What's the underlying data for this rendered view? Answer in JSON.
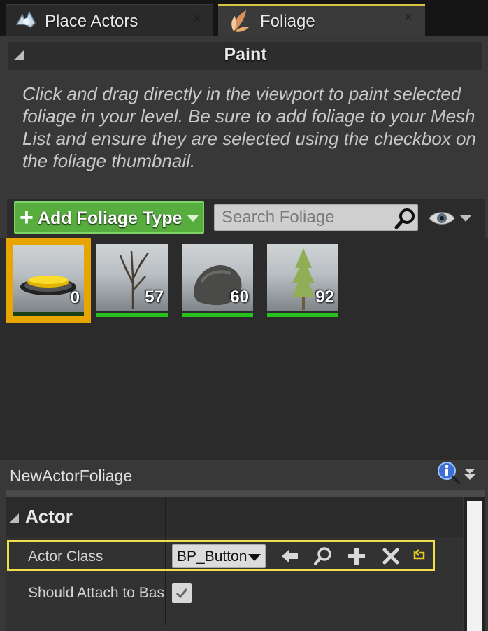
{
  "tabs": [
    {
      "label": "Place Actors",
      "active": false
    },
    {
      "label": "Foliage",
      "active": true
    }
  ],
  "paint": {
    "title": "Paint",
    "instructions": "Click and drag directly in the viewport to paint selected foliage in your level. Be sure to add foliage to your Mesh List and ensure they are selected using the checkbox on the foliage thumbnail."
  },
  "toolbar": {
    "add_label": "Add Foliage Type",
    "search_placeholder": "Search Foliage"
  },
  "foliage_types": [
    {
      "count": "0",
      "selected": true,
      "icon": "yellow-button"
    },
    {
      "count": "57",
      "selected": false,
      "icon": "bare-tree"
    },
    {
      "count": "60",
      "selected": false,
      "icon": "rock"
    },
    {
      "count": "92",
      "selected": false,
      "icon": "pine-tree"
    }
  ],
  "details": {
    "title": "NewActorFoliage",
    "category": "Actor",
    "actor_class_label": "Actor Class",
    "actor_class_value": "BP_Button",
    "attach_label": "Should Attach to Bas",
    "attach_checked": true
  },
  "colors": {
    "accent": "#f0e04b",
    "add_button": "#58ad3f",
    "selection": "#e8a400",
    "active_tab": "#d7c442"
  }
}
